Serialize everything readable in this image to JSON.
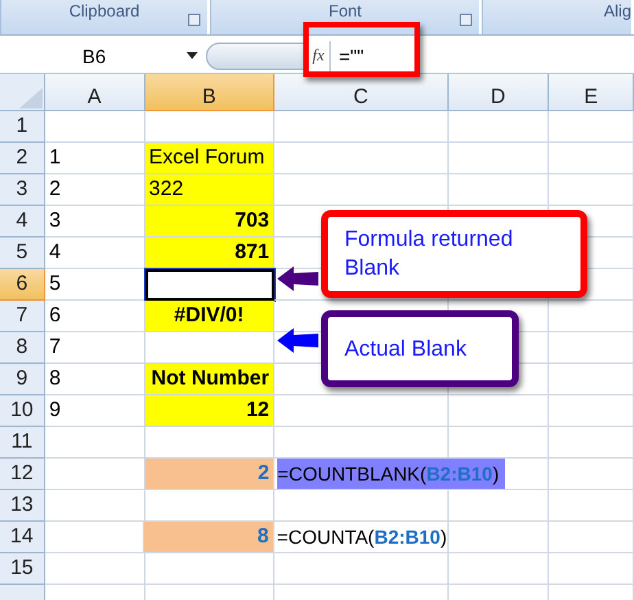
{
  "ribbon_groups": [
    {
      "label": "Clipboard"
    },
    {
      "label": "Font"
    },
    {
      "label": "Alig"
    }
  ],
  "formula_bar": {
    "name_box": "B6",
    "function_label": "fx",
    "formula": "=\"\""
  },
  "columns": [
    {
      "label": "A",
      "selected": false
    },
    {
      "label": "B",
      "selected": true
    },
    {
      "label": "C",
      "selected": false
    },
    {
      "label": "D",
      "selected": false
    },
    {
      "label": "E",
      "selected": false
    }
  ],
  "rows": [
    {
      "header": "1",
      "selected": false,
      "cells": [
        {},
        {},
        {},
        {},
        {}
      ]
    },
    {
      "header": "2",
      "selected": false,
      "cells": [
        {
          "text": "1"
        },
        {
          "text": "Excel Forum",
          "color": "#ffff00"
        },
        {},
        {},
        {}
      ]
    },
    {
      "header": "3",
      "selected": false,
      "cells": [
        {
          "text": "2"
        },
        {
          "text": "322",
          "color": "#ffff00"
        },
        {},
        {},
        {}
      ]
    },
    {
      "header": "4",
      "selected": false,
      "cells": [
        {
          "text": "3"
        },
        {
          "text": "703",
          "color": "#ffff00",
          "kind": "number"
        },
        {},
        {},
        {}
      ]
    },
    {
      "header": "5",
      "selected": false,
      "cells": [
        {
          "text": "4"
        },
        {
          "text": "871",
          "color": "#ffff00",
          "kind": "number"
        },
        {},
        {},
        {}
      ]
    },
    {
      "header": "6",
      "selected": true,
      "cells": [
        {
          "text": "5"
        },
        {
          "selected": true
        },
        {},
        {},
        {}
      ]
    },
    {
      "header": "7",
      "selected": false,
      "cells": [
        {
          "text": "6"
        },
        {
          "text": "#DIV/0!",
          "color": "#ffff00",
          "kind": "error"
        },
        {},
        {},
        {}
      ]
    },
    {
      "header": "8",
      "selected": false,
      "cells": [
        {
          "text": "7"
        },
        {},
        {},
        {},
        {}
      ]
    },
    {
      "header": "9",
      "selected": false,
      "cells": [
        {
          "text": "8"
        },
        {
          "text": "Not Number",
          "color": "#ffff00",
          "kind": "number"
        },
        {},
        {},
        {}
      ]
    },
    {
      "header": "10",
      "selected": false,
      "cells": [
        {
          "text": "9"
        },
        {
          "text": "12",
          "color": "#ffff00",
          "kind": "number"
        },
        {},
        {},
        {}
      ]
    },
    {
      "header": "11",
      "selected": false,
      "cells": [
        {},
        {},
        {},
        {},
        {}
      ]
    },
    {
      "header": "12",
      "selected": false,
      "cells": [
        {},
        {
          "text": "2",
          "color": "#f9c08f",
          "kind": "count"
        },
        {
          "text": "=COUNTBLANK(**B2:B10**)",
          "kind": "formula",
          "color": "#8080ff"
        },
        {},
        {}
      ]
    },
    {
      "header": "13",
      "selected": false,
      "cells": [
        {},
        {},
        {},
        {},
        {}
      ]
    },
    {
      "header": "14",
      "selected": false,
      "cells": [
        {},
        {
          "text": "8",
          "color": "#f9c08f",
          "kind": "count"
        },
        {
          "text": "=COUNTA(**B2:B10**)",
          "kind": "formula"
        },
        {},
        {}
      ]
    },
    {
      "header": "15",
      "selected": false,
      "cells": [
        {},
        {},
        {},
        {},
        {}
      ]
    }
  ],
  "callouts": [
    {
      "text": "Formula returned Blank",
      "color": "#ff0000",
      "arrow": {
        "color": "#4b0082"
      }
    },
    {
      "text": "Actual Blank",
      "color": "#4b0082",
      "arrow": {
        "color": "#0000ff"
      }
    }
  ]
}
